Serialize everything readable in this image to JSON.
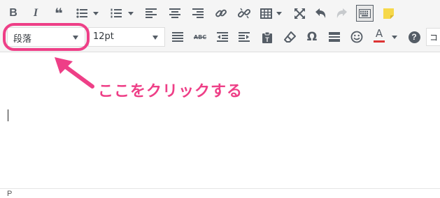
{
  "toolbar": {
    "row1": [
      "bold-icon",
      "italic-icon",
      "blockquote-icon",
      "bullet-list-icon",
      "numbered-list-icon",
      "align-left-icon",
      "align-center-icon",
      "align-right-icon",
      "link-icon",
      "unlink-icon",
      "table-icon",
      "fullscreen-icon",
      "undo-icon",
      "redo-icon",
      "keyboard-icon",
      "note-icon"
    ],
    "row2": [
      "align-justify-icon",
      "strikethrough-icon",
      "outdent-icon",
      "indent-icon",
      "paste-text-icon",
      "eraser-icon",
      "omega-icon",
      "horizontal-rule-icon",
      "emoji-icon",
      "text-color-icon",
      "help-icon"
    ],
    "bold_label": "B",
    "italic_label": "I",
    "quote_label": "❝",
    "abc_label": "ABC",
    "omega_label": "Ω",
    "text_color_label": "A",
    "help_label": "?",
    "format_select": {
      "value": "段落"
    },
    "fontsize_select": {
      "value": "12pt"
    },
    "cut_off_label": "コ"
  },
  "colors": {
    "accent": "#ee3f87",
    "text_color_underline": "#dd3333",
    "note_yellow": "#f6d84a"
  },
  "annotation": {
    "text": "ここをクリックする"
  },
  "statusbar": {
    "path": "P"
  }
}
